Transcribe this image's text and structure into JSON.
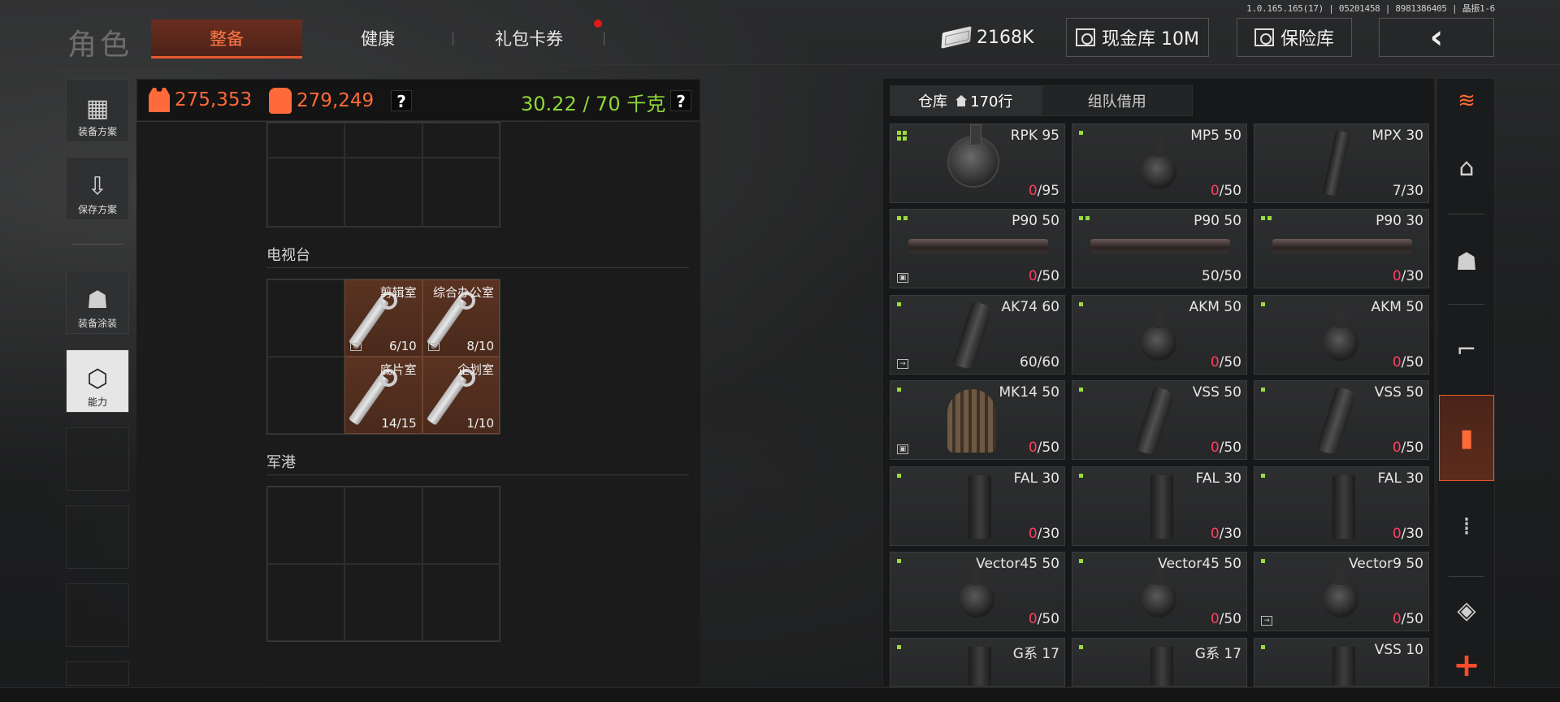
{
  "version": "1.0.165.165(17) | 05201458 | 8981386405 | 晶振1-6",
  "title": "角色",
  "tabs": {
    "equip": "整备",
    "health": "健康",
    "gift": "礼包卡券"
  },
  "currency": {
    "value": "2168K"
  },
  "top_buttons": {
    "cash_vault": "现金库 10M",
    "safe": "保险库",
    "back": "‹"
  },
  "sidebar": {
    "loadout": "装备方案",
    "save": "保存方案",
    "skin": "装备涂装",
    "ability": "能力"
  },
  "stats": {
    "armor_value": "275,353",
    "bag_value": "279,249",
    "weight": "30.22 / 70 千克",
    "help": "?"
  },
  "sections": {
    "tv": "电视台",
    "port": "军港"
  },
  "keys": [
    {
      "name": "剪辑室",
      "count": "6/10"
    },
    {
      "name": "综合办公室",
      "count": "8/10"
    },
    {
      "name": "底片室",
      "count": "14/15"
    },
    {
      "name": "企划室",
      "count": "1/10"
    }
  ],
  "warehouse": {
    "tab_storage": "仓库",
    "tab_rows": "170行",
    "tab_team": "组队借用"
  },
  "items": [
    {
      "name": "RPK 95",
      "cur": "0",
      "max": "/95",
      "shape": "drum",
      "tag": "four",
      "full": false
    },
    {
      "name": "MP5 50",
      "cur": "0",
      "max": "/50",
      "shape": "drum-sm",
      "tag": "one",
      "full": false
    },
    {
      "name": "MPX 30",
      "cur": "7",
      "max": "/30",
      "shape": "stick",
      "tag": "none",
      "full": true
    },
    {
      "name": "P90 50",
      "cur": "0",
      "max": "/50",
      "shape": "flat",
      "tag": "two",
      "full": false,
      "corner": "box"
    },
    {
      "name": "P90 50",
      "cur": "50",
      "max": "/50",
      "shape": "flat",
      "tag": "two",
      "full": true
    },
    {
      "name": "P90 30",
      "cur": "0",
      "max": "/30",
      "shape": "flat",
      "tag": "two",
      "full": false
    },
    {
      "name": "AK74 60",
      "cur": "60",
      "max": "/60",
      "shape": "curve",
      "tag": "one",
      "full": true,
      "corner": "exit"
    },
    {
      "name": "AKM 50",
      "cur": "0",
      "max": "/50",
      "shape": "drum-sm",
      "tag": "one",
      "full": false
    },
    {
      "name": "AKM 50",
      "cur": "0",
      "max": "/50",
      "shape": "drum-sm",
      "tag": "one",
      "full": false
    },
    {
      "name": "MK14 50",
      "cur": "0",
      "max": "/50",
      "shape": "tan",
      "tag": "one",
      "full": false,
      "corner": "box"
    },
    {
      "name": "VSS 50",
      "cur": "0",
      "max": "/50",
      "shape": "curve",
      "tag": "one",
      "full": false
    },
    {
      "name": "VSS 50",
      "cur": "0",
      "max": "/50",
      "shape": "curve",
      "tag": "one",
      "full": false
    },
    {
      "name": "FAL 30",
      "cur": "0",
      "max": "/30",
      "shape": "box",
      "tag": "one",
      "full": false
    },
    {
      "name": "FAL 30",
      "cur": "0",
      "max": "/30",
      "shape": "box",
      "tag": "one",
      "full": false
    },
    {
      "name": "FAL 30",
      "cur": "0",
      "max": "/30",
      "shape": "box",
      "tag": "one",
      "full": false
    },
    {
      "name": "Vector45 50",
      "cur": "0",
      "max": "/50",
      "shape": "drum-sm",
      "tag": "one",
      "full": false
    },
    {
      "name": "Vector45 50",
      "cur": "0",
      "max": "/50",
      "shape": "drum-sm",
      "tag": "one",
      "full": false
    },
    {
      "name": "Vector9 50",
      "cur": "0",
      "max": "/50",
      "shape": "drum-sm",
      "tag": "one",
      "full": false,
      "corner": "exit"
    },
    {
      "name": "G系 17",
      "cur": "",
      "max": "",
      "shape": "box",
      "tag": "one",
      "full": true
    },
    {
      "name": "G系 17",
      "cur": "",
      "max": "",
      "shape": "box",
      "tag": "one",
      "full": true
    },
    {
      "name": "VSS 10",
      "cur": "",
      "max": "",
      "shape": "box",
      "tag": "one",
      "full": true
    }
  ],
  "colors": {
    "accent": "#e4572e",
    "armor": "#ff6a3a",
    "weight_ok": "#8fd83a",
    "empty_qty": "#ff3f5f",
    "tag": "#9bdb3f"
  },
  "icons": {
    "cat_top": "sort-icon",
    "cat_home": "home-icon",
    "cat_helmet": "helmet-icon",
    "cat_rifle": "rifle-icon",
    "cat_magazine": "magazine-icon",
    "cat_ammo": "ammo-icon",
    "cat_scope": "scope-icon",
    "cat_plus": "plus-icon"
  }
}
